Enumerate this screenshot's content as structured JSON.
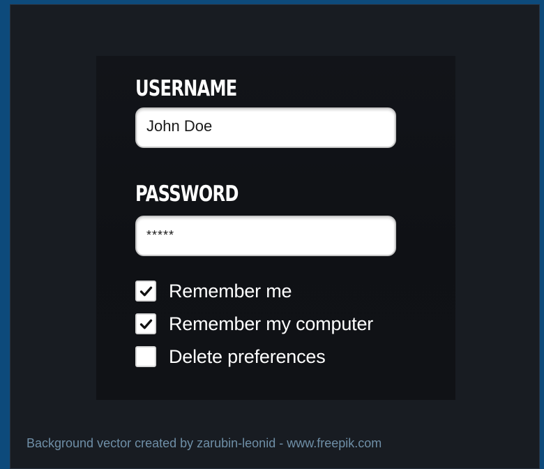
{
  "form": {
    "username_label": "USERNAME",
    "username_value": "John Doe",
    "password_label": "PASSWORD",
    "password_value": "*****",
    "options": [
      {
        "label": "Remember me",
        "checked": true
      },
      {
        "label": "Remember my computer",
        "checked": true
      },
      {
        "label": "Delete preferences",
        "checked": false
      }
    ]
  },
  "credit": {
    "text": "Background vector created by zarubin-leonid - www.freepik.com"
  },
  "icons": {
    "check": "check-icon"
  },
  "colors": {
    "outer_background": "#0d4a7b",
    "panel_background": "#181c22",
    "text": "#ffffff",
    "field_background": "#ffffff"
  }
}
